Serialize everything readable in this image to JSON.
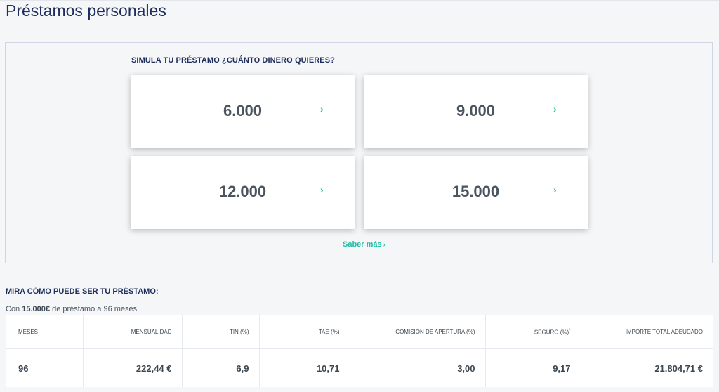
{
  "page": {
    "title": "Préstamos personales"
  },
  "simulator": {
    "heading": "SIMULA TU PRÉSTAMO ¿CUÁNTO DINERO QUIERES?",
    "amounts": [
      {
        "value": "6.000",
        "icon": "chevron-right-icon"
      },
      {
        "value": "9.000",
        "icon": "chevron-right-icon"
      },
      {
        "value": "12.000",
        "icon": "chevron-right-icon"
      },
      {
        "value": "15.000",
        "icon": "chevron-right-icon"
      }
    ],
    "chevron": "›",
    "more_link": "Saber más",
    "more_link_arrow": "›"
  },
  "example": {
    "heading": "MIRA CÓMO PUEDE SER TU PRÉSTAMO:",
    "desc_prefix": "Con ",
    "desc_amount": "15.000€",
    "desc_suffix": " de préstamo a 96 meses",
    "columns": [
      "MESES",
      "MENSUALIDAD",
      "TIN (%)",
      "TAE (%)",
      "COMISIÓN DE APERTURA (%)",
      "SEGURO (%)",
      "IMPORTE TOTAL ADEUDADO"
    ],
    "insurance_note": "*",
    "row": [
      "96",
      "222,44 €",
      "6,9",
      "10,71",
      "3,00",
      "9,17",
      "21.804,71 €"
    ]
  },
  "colors": {
    "accent": "#1bbfa3",
    "title": "#1f2d5c",
    "value_text": "#4a5560",
    "background": "#f4f6f8"
  }
}
